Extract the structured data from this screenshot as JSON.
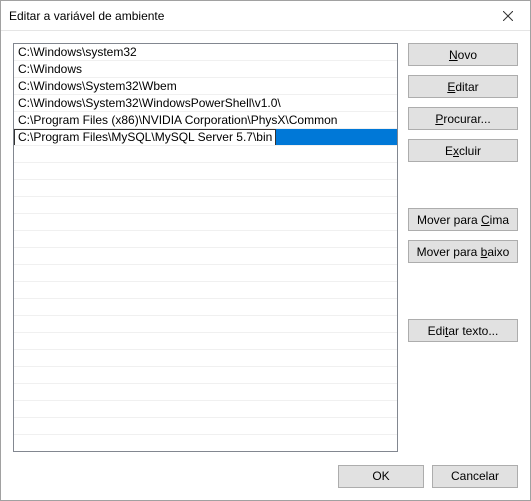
{
  "window": {
    "title": "Editar a variável de ambiente"
  },
  "list": {
    "items": [
      "C:\\Windows\\system32",
      "C:\\Windows",
      "C:\\Windows\\System32\\Wbem",
      "C:\\Windows\\System32\\WindowsPowerShell\\v1.0\\",
      "C:\\Program Files (x86)\\NVIDIA Corporation\\PhysX\\Common",
      "C:\\Program Files\\MySQL\\MySQL Server 5.7\\bin"
    ],
    "selected_index": 5,
    "editing_value": "C:\\Program Files\\MySQL\\MySQL Server 5.7\\bin"
  },
  "buttons": {
    "novo_pre": "",
    "novo_u": "N",
    "novo_post": "ovo",
    "editar_pre": "",
    "editar_u": "E",
    "editar_post": "ditar",
    "procurar_pre": "",
    "procurar_u": "P",
    "procurar_post": "rocurar...",
    "excluir_pre": "E",
    "excluir_u": "x",
    "excluir_post": "cluir",
    "moverc_pre": "Mover para ",
    "moverc_u": "C",
    "moverc_post": "ima",
    "moverb_pre": "Mover para ",
    "moverb_u": "b",
    "moverb_post": "aixo",
    "edtxt_pre": "Edi",
    "edtxt_u": "t",
    "edtxt_post": "ar texto...",
    "ok": "OK",
    "cancelar": "Cancelar"
  }
}
